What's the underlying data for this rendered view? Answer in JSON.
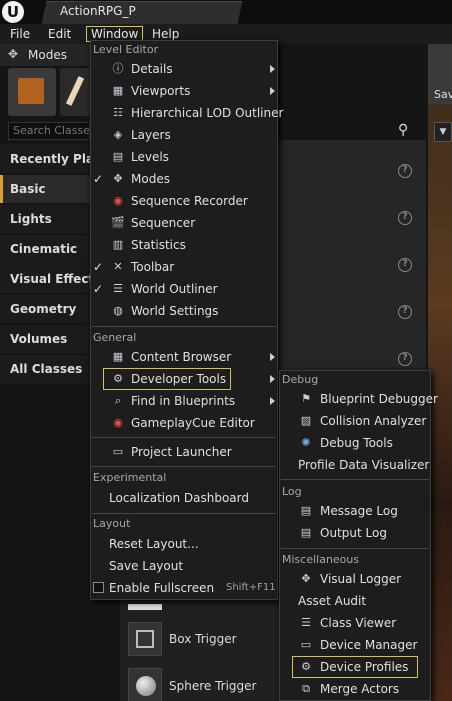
{
  "window": {
    "doc_tab_title": "ActionRPG_P"
  },
  "menubar": {
    "items": [
      "File",
      "Edit",
      "Window",
      "Help"
    ]
  },
  "modes_panel": {
    "title": "Modes",
    "search_placeholder": "Search Classes",
    "categories": [
      "Recently Placed",
      "Basic",
      "Lights",
      "Cinematic",
      "Visual Effects",
      "Geometry",
      "Volumes",
      "All Classes"
    ],
    "items": [
      "Box Trigger",
      "Sphere Trigger"
    ]
  },
  "window_menu": {
    "sections": {
      "level_editor": "Level Editor",
      "general": "General",
      "experimental": "Experimental",
      "layout": "Layout"
    },
    "level_editor_items": [
      {
        "label": "Details",
        "icon": "details-icon",
        "submenu": true,
        "checked": false
      },
      {
        "label": "Viewports",
        "icon": "viewports-icon",
        "submenu": true,
        "checked": false
      },
      {
        "label": "Hierarchical LOD Outliner",
        "icon": "hlod-icon",
        "submenu": false,
        "checked": false
      },
      {
        "label": "Layers",
        "icon": "layers-icon",
        "submenu": false,
        "checked": false
      },
      {
        "label": "Levels",
        "icon": "levels-icon",
        "submenu": false,
        "checked": false
      },
      {
        "label": "Modes",
        "icon": "modes-icon",
        "submenu": false,
        "checked": true
      },
      {
        "label": "Sequence Recorder",
        "icon": "record-icon",
        "submenu": false,
        "checked": false
      },
      {
        "label": "Sequencer",
        "icon": "sequencer-icon",
        "submenu": false,
        "checked": false
      },
      {
        "label": "Statistics",
        "icon": "statistics-icon",
        "submenu": false,
        "checked": false
      },
      {
        "label": "Toolbar",
        "icon": "toolbar-icon",
        "submenu": false,
        "checked": true
      },
      {
        "label": "World Outliner",
        "icon": "outliner-icon",
        "submenu": false,
        "checked": true
      },
      {
        "label": "World Settings",
        "icon": "world-settings-icon",
        "submenu": false,
        "checked": false
      }
    ],
    "general_items": [
      {
        "label": "Content Browser",
        "icon": "content-browser-icon",
        "submenu": true
      },
      {
        "label": "Developer Tools",
        "icon": "developer-tools-icon",
        "submenu": true,
        "highlighted": true
      },
      {
        "label": "Find in Blueprints",
        "icon": "find-blueprints-icon",
        "submenu": true
      },
      {
        "label": "GameplayCue Editor",
        "icon": "gameplaycue-icon",
        "submenu": false
      },
      {
        "label": "Project Launcher",
        "icon": "launcher-icon",
        "submenu": false
      }
    ],
    "experimental_items": [
      {
        "label": "Localization Dashboard"
      }
    ],
    "layout_items": [
      {
        "label": "Reset Layout..."
      },
      {
        "label": "Save Layout"
      },
      {
        "label": "Enable Fullscreen",
        "shortcut": "Shift+F11",
        "checked": false
      }
    ]
  },
  "developer_tools_submenu": {
    "sections": {
      "debug": "Debug",
      "log": "Log",
      "misc": "Miscellaneous"
    },
    "debug_items": [
      {
        "label": "Blueprint Debugger",
        "icon": "blueprint-debugger-icon"
      },
      {
        "label": "Collision Analyzer",
        "icon": "collision-analyzer-icon"
      },
      {
        "label": "Debug Tools",
        "icon": "debug-tools-icon"
      },
      {
        "label": "Profile Data Visualizer",
        "icon": ""
      }
    ],
    "log_items": [
      {
        "label": "Message Log",
        "icon": "message-log-icon"
      },
      {
        "label": "Output Log",
        "icon": "output-log-icon"
      }
    ],
    "misc_items": [
      {
        "label": "Visual Logger",
        "icon": "visual-logger-icon"
      },
      {
        "label": "Asset Audit",
        "icon": ""
      },
      {
        "label": "Class Viewer",
        "icon": "class-viewer-icon"
      },
      {
        "label": "Device Manager",
        "icon": "device-manager-icon"
      },
      {
        "label": "Device Profiles",
        "icon": "device-profiles-icon",
        "highlighted": true
      },
      {
        "label": "Merge Actors",
        "icon": "merge-actors-icon"
      }
    ]
  },
  "viewport": {
    "toolbar_label_partial": "Sav"
  }
}
